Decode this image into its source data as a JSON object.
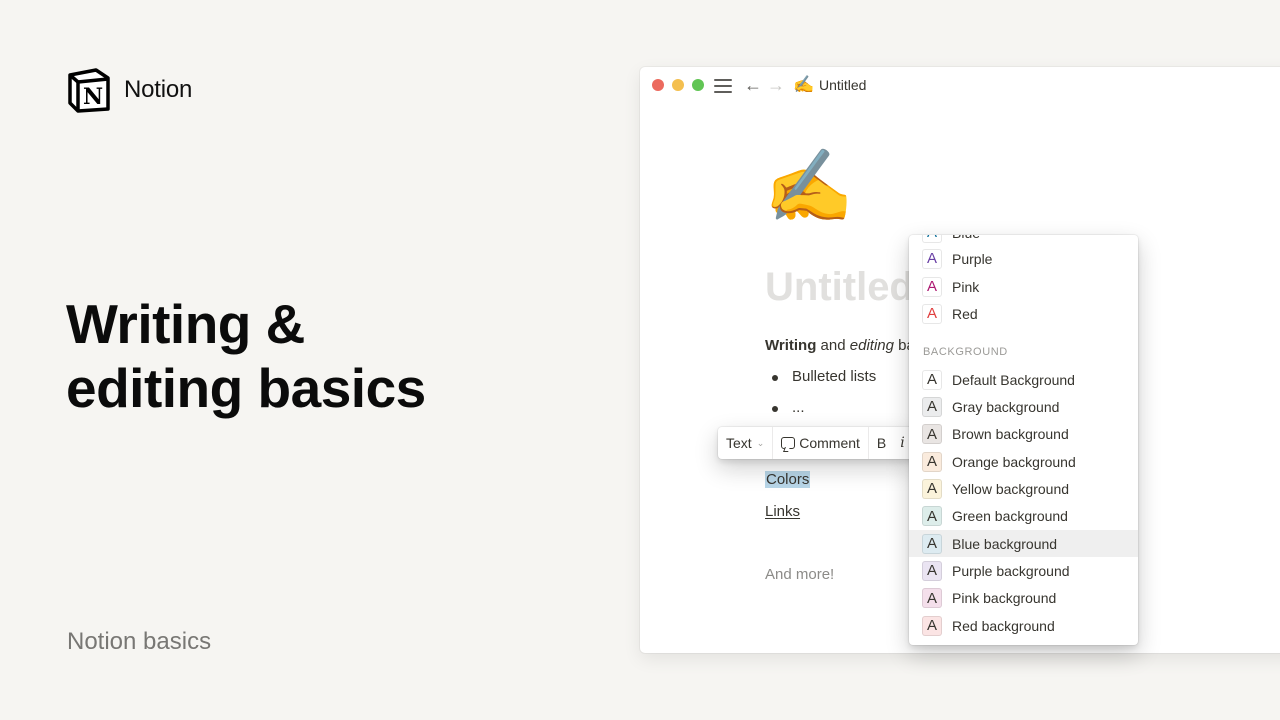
{
  "brand": {
    "name": "Notion",
    "logo_letter": "N"
  },
  "headline": [
    "Writing &",
    "editing basics"
  ],
  "subtitle": "Notion basics",
  "window": {
    "nav": {
      "menu_icon": "hamburger-icon",
      "back_icon": "←",
      "forward_icon": "→"
    },
    "tab_emoji": "✍️",
    "tab_title": "Untitled",
    "page": {
      "emoji": "✍️",
      "title_placeholder": "Untitled",
      "intro": {
        "bold": "Writing",
        "mid": " and ",
        "italic": "editing",
        "rest": " ba"
      },
      "bullets": [
        "Bulleted lists",
        "..."
      ],
      "colors_text": "Colors",
      "links_text": "Links",
      "more_text": "And more!"
    },
    "toolbar": {
      "turn_into": "Text",
      "chevron": "⌄",
      "comment": "Comment",
      "bold": "B",
      "italic": "i"
    },
    "color_menu": {
      "text_colors": [
        {
          "label": "Blue",
          "color": "#0b6e99",
          "bg": "#ffffff"
        },
        {
          "label": "Purple",
          "color": "#6940a5",
          "bg": "#ffffff"
        },
        {
          "label": "Pink",
          "color": "#ad1a72",
          "bg": "#ffffff"
        },
        {
          "label": "Red",
          "color": "#e03e3e",
          "bg": "#ffffff"
        }
      ],
      "section_label": "BACKGROUND",
      "swatch_glyph": "A",
      "backgrounds": [
        {
          "label": "Default Background",
          "bg": "#ffffff"
        },
        {
          "label": "Gray background",
          "bg": "#ebeced"
        },
        {
          "label": "Brown background",
          "bg": "#e9e5e3"
        },
        {
          "label": "Orange background",
          "bg": "#faebdd"
        },
        {
          "label": "Yellow background",
          "bg": "#fbf3db"
        },
        {
          "label": "Green background",
          "bg": "#ddedea"
        },
        {
          "label": "Blue background",
          "bg": "#ddebf1",
          "hovered": true
        },
        {
          "label": "Purple background",
          "bg": "#eae4f2"
        },
        {
          "label": "Pink background",
          "bg": "#f4dfeb"
        },
        {
          "label": "Red background",
          "bg": "#fbe4e4"
        }
      ]
    }
  }
}
